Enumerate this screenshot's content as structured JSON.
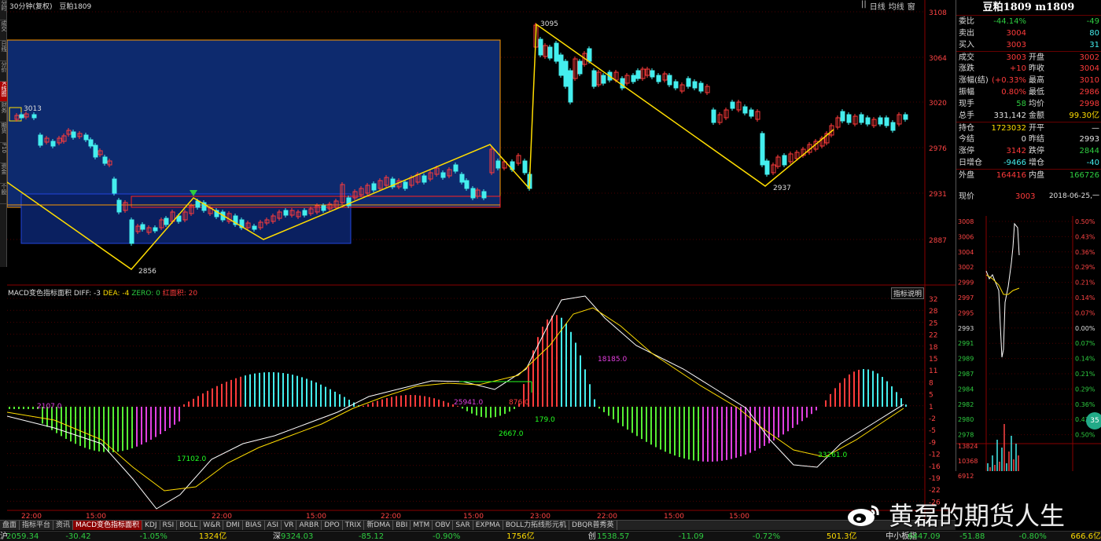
{
  "header": {
    "period": "30分钟(复权)",
    "symbol": "豆粕1809",
    "controls": [
      "||",
      "日线",
      "均线",
      "窗"
    ]
  },
  "sidebar_tabs": [
    "分时",
    "成交",
    "日线",
    "分价",
    "K线图",
    "财务",
    "期货",
    "F10",
    "资金",
    "个股"
  ],
  "price_axis": [
    "3108",
    "3064",
    "3020",
    "2976",
    "2931",
    "2887"
  ],
  "price_annotations": {
    "high": "3095",
    "left": "3013",
    "low": "2856",
    "right_low": "2937"
  },
  "macd": {
    "name": "MACD变色指标面积",
    "diff": "DIFF: -3",
    "dea": "DEA: -4",
    "zero": "ZERO: 0",
    "red_area": "红面积: 20",
    "button": "指标说明",
    "axis": [
      "32",
      "28",
      "25",
      "22",
      "18",
      "15",
      "11",
      "8",
      "5",
      "1",
      "-2",
      "-5",
      "-9",
      "-12",
      "-16",
      "-19",
      "-22",
      "-26"
    ],
    "area_labels": [
      "2107.0",
      "17102.0",
      "25941.0",
      "876.0",
      "2667.0",
      "179.0",
      "18185.0",
      "33261.0"
    ]
  },
  "time_axis": [
    "22:00",
    "15:00",
    "22:00",
    "15:00",
    "22:00",
    "15:00",
    "23:00",
    "22:00",
    "15:00",
    "15:00"
  ],
  "info": {
    "title": "豆粕1809 m1809",
    "rows": [
      {
        "l": "委比",
        "v": "-44.14%",
        "vc": "green",
        "l2": "",
        "v2": "-49",
        "v2c": "green"
      },
      {
        "l": "卖出",
        "v": "3004",
        "vc": "red",
        "l2": "",
        "v2": "80",
        "v2c": "cyan"
      },
      {
        "l": "买入",
        "v": "3003",
        "vc": "red",
        "l2": "",
        "v2": "31",
        "v2c": "cyan"
      },
      {
        "l": "成交",
        "v": "3003",
        "vc": "red",
        "l2": "开盘",
        "v2": "3002",
        "v2c": "red"
      },
      {
        "l": "涨跌",
        "v": "+10",
        "vc": "red",
        "l2": "昨收",
        "v2": "3004",
        "v2c": "red"
      },
      {
        "l": "涨幅(结)",
        "v": "(+0.33%",
        "vc": "red",
        "l2": "最高",
        "v2": "3010",
        "v2c": "red"
      },
      {
        "l": "振幅",
        "v": "0.80%",
        "vc": "red",
        "l2": "最低",
        "v2": "2986",
        "v2c": "red"
      },
      {
        "l": "现手",
        "v": "58",
        "vc": "green",
        "l2": "均价",
        "v2": "2998",
        "v2c": "red"
      },
      {
        "l": "总手",
        "v": "331,142",
        "vc": "white",
        "l2": "金额",
        "v2": "99.30亿",
        "v2c": "yellow"
      },
      {
        "l": "持仓",
        "v": "1723032",
        "vc": "yellow",
        "l2": "开平",
        "v2": "—",
        "v2c": "white"
      },
      {
        "l": "今结",
        "v": "0",
        "vc": "white",
        "l2": "昨结",
        "v2": "2993",
        "v2c": "white"
      },
      {
        "l": "涨停",
        "v": "3142",
        "vc": "red",
        "l2": "跌停",
        "v2": "2844",
        "v2c": "green"
      },
      {
        "l": "日增仓",
        "v": "-9466",
        "vc": "cyan",
        "l2": "增仓",
        "v2": "-40",
        "v2c": "cyan"
      },
      {
        "l": "外盘",
        "v": "164416",
        "vc": "red",
        "l2": "内盘",
        "v2": "166726",
        "v2c": "green"
      }
    ],
    "now_label": "现价",
    "now_value": "3003",
    "date": "2018-06-25,一",
    "mini_left_axis": [
      "3008",
      "3006",
      "3004",
      "3002",
      "2999",
      "2997",
      "2995",
      "2993",
      "2991",
      "2989",
      "2987",
      "2984",
      "2982",
      "2980",
      "2978"
    ],
    "mini_right_axis": [
      "0.50%",
      "0.43%",
      "0.36%",
      "0.29%",
      "0.21%",
      "0.14%",
      "0.07%",
      "0.00%",
      "0.07%",
      "0.14%",
      "0.21%",
      "0.29%",
      "0.36%",
      "0.43%",
      "0.50%"
    ],
    "vol_axis": [
      "13824",
      "10368",
      "6912"
    ],
    "badge": "35"
  },
  "bottom_tabs": [
    "盘面",
    "指标平台",
    "资讯",
    "MACD变色指标面积",
    "KDJ",
    "RSI",
    "BOLL",
    "W&R",
    "DMI",
    "BIAS",
    "ASI",
    "VR",
    "ARBR",
    "DPO",
    "TRIX",
    "新DMA",
    "BBI",
    "MTM",
    "OBV",
    "SAR",
    "EXPMA",
    "BOLL力拓线形元机",
    "DBQR普秀英"
  ],
  "status_bar": [
    {
      "t": "沪",
      "c": "white"
    },
    {
      "t": "2059.34",
      "c": "green"
    },
    {
      "t": "-30.42",
      "c": "green"
    },
    {
      "t": "-1.05%",
      "c": "green"
    },
    {
      "t": "1324亿",
      "c": "yellow"
    },
    {
      "t": "深",
      "c": "white"
    },
    {
      "t": "9324.03",
      "c": "green"
    },
    {
      "t": "-85.12",
      "c": "green"
    },
    {
      "t": "-0.90%",
      "c": "green"
    },
    {
      "t": "1756亿",
      "c": "yellow"
    },
    {
      "t": "创",
      "c": "white"
    },
    {
      "t": "1538.57",
      "c": "green"
    },
    {
      "t": "-11.09",
      "c": "green"
    },
    {
      "t": "-0.72%",
      "c": "green"
    },
    {
      "t": "501.3亿",
      "c": "yellow"
    },
    {
      "t": "中小板指",
      "c": "white"
    },
    {
      "t": "6447.09",
      "c": "green"
    },
    {
      "t": "-51.88",
      "c": "green"
    },
    {
      "t": "-0.80%",
      "c": "green"
    },
    {
      "t": "666.6亿",
      "c": "yellow"
    }
  ],
  "watermark": "黄磊的期货人生",
  "colors": {
    "up": "#ff3b3b",
    "down": "#4ee",
    "neg_hist": "#e040e0",
    "pos_hist": "#ff3b3b",
    "line_yellow": "#ffdd00"
  }
}
